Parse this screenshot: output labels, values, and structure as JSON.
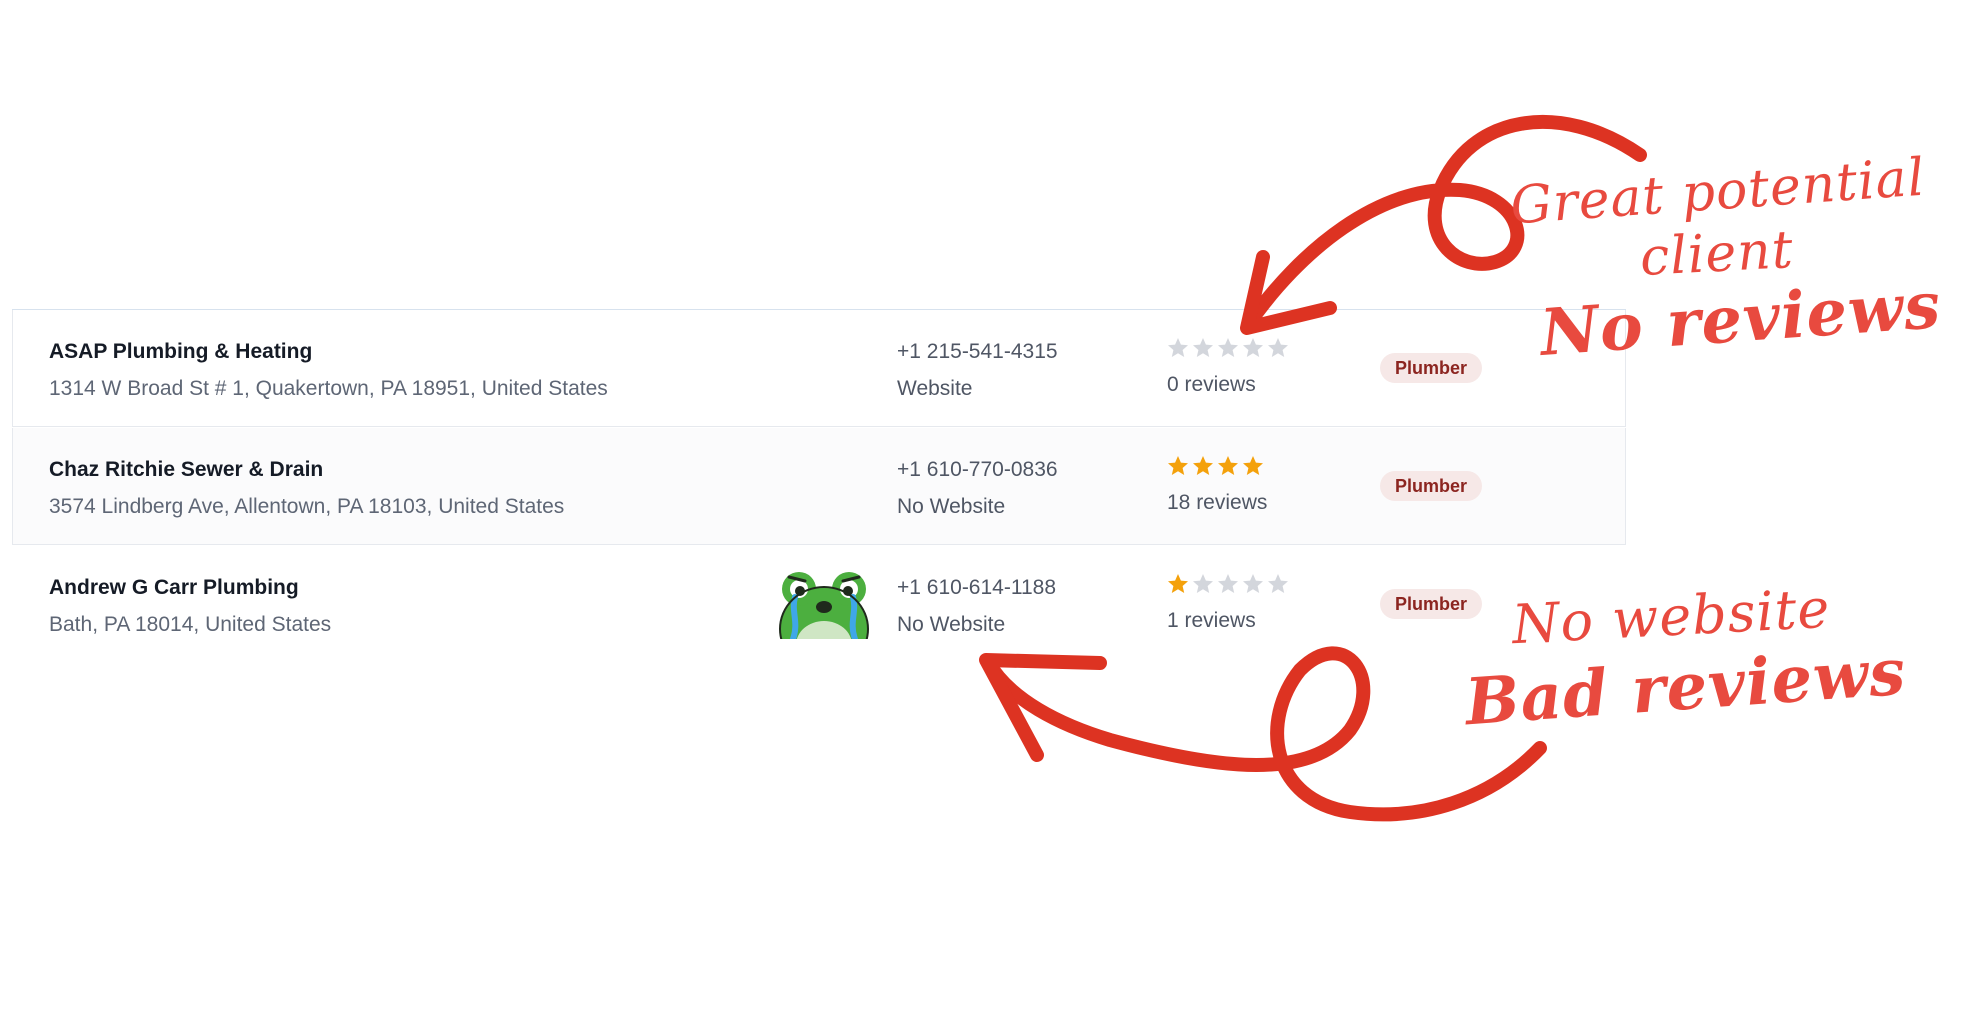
{
  "listing": {
    "rows": [
      {
        "name": "ASAP Plumbing & Heating",
        "address": "1314 W Broad St # 1, Quakertown, PA 18951, United States",
        "phone": "+1 215-541-4315",
        "website": "Website",
        "rating_stars_filled": 0,
        "rating_stars_total": 5,
        "reviews": "0 reviews",
        "category": "Plumber"
      },
      {
        "name": "Chaz Ritchie Sewer & Drain",
        "address": "3574 Lindberg Ave, Allentown, PA 18103, United States",
        "phone": "+1 610-770-0836",
        "website": "No Website",
        "rating_stars_filled": 4,
        "rating_stars_total": 4,
        "reviews": "18 reviews",
        "category": "Plumber"
      },
      {
        "name": "Andrew G Carr Plumbing",
        "address": "Bath, PA 18014, United States",
        "phone": "+1 610-614-1188",
        "website": "No Website",
        "rating_stars_filled": 1,
        "rating_stars_total": 5,
        "reviews": "1 reviews",
        "category": "Plumber",
        "sticker": "crying-frog-icon"
      }
    ]
  },
  "annotations": {
    "top_line1": "Great potential",
    "top_line2": "client",
    "top_line3": "No reviews",
    "bottom_line1": "No website",
    "bottom_line2": "Bad reviews"
  },
  "colors": {
    "star_filled": "#f4a10b",
    "star_empty": "#d3d6dc",
    "badge_bg": "#f6e8e7",
    "badge_text": "#8c2520",
    "annotation": "#e84a3f",
    "arrow": "#dd3322"
  }
}
